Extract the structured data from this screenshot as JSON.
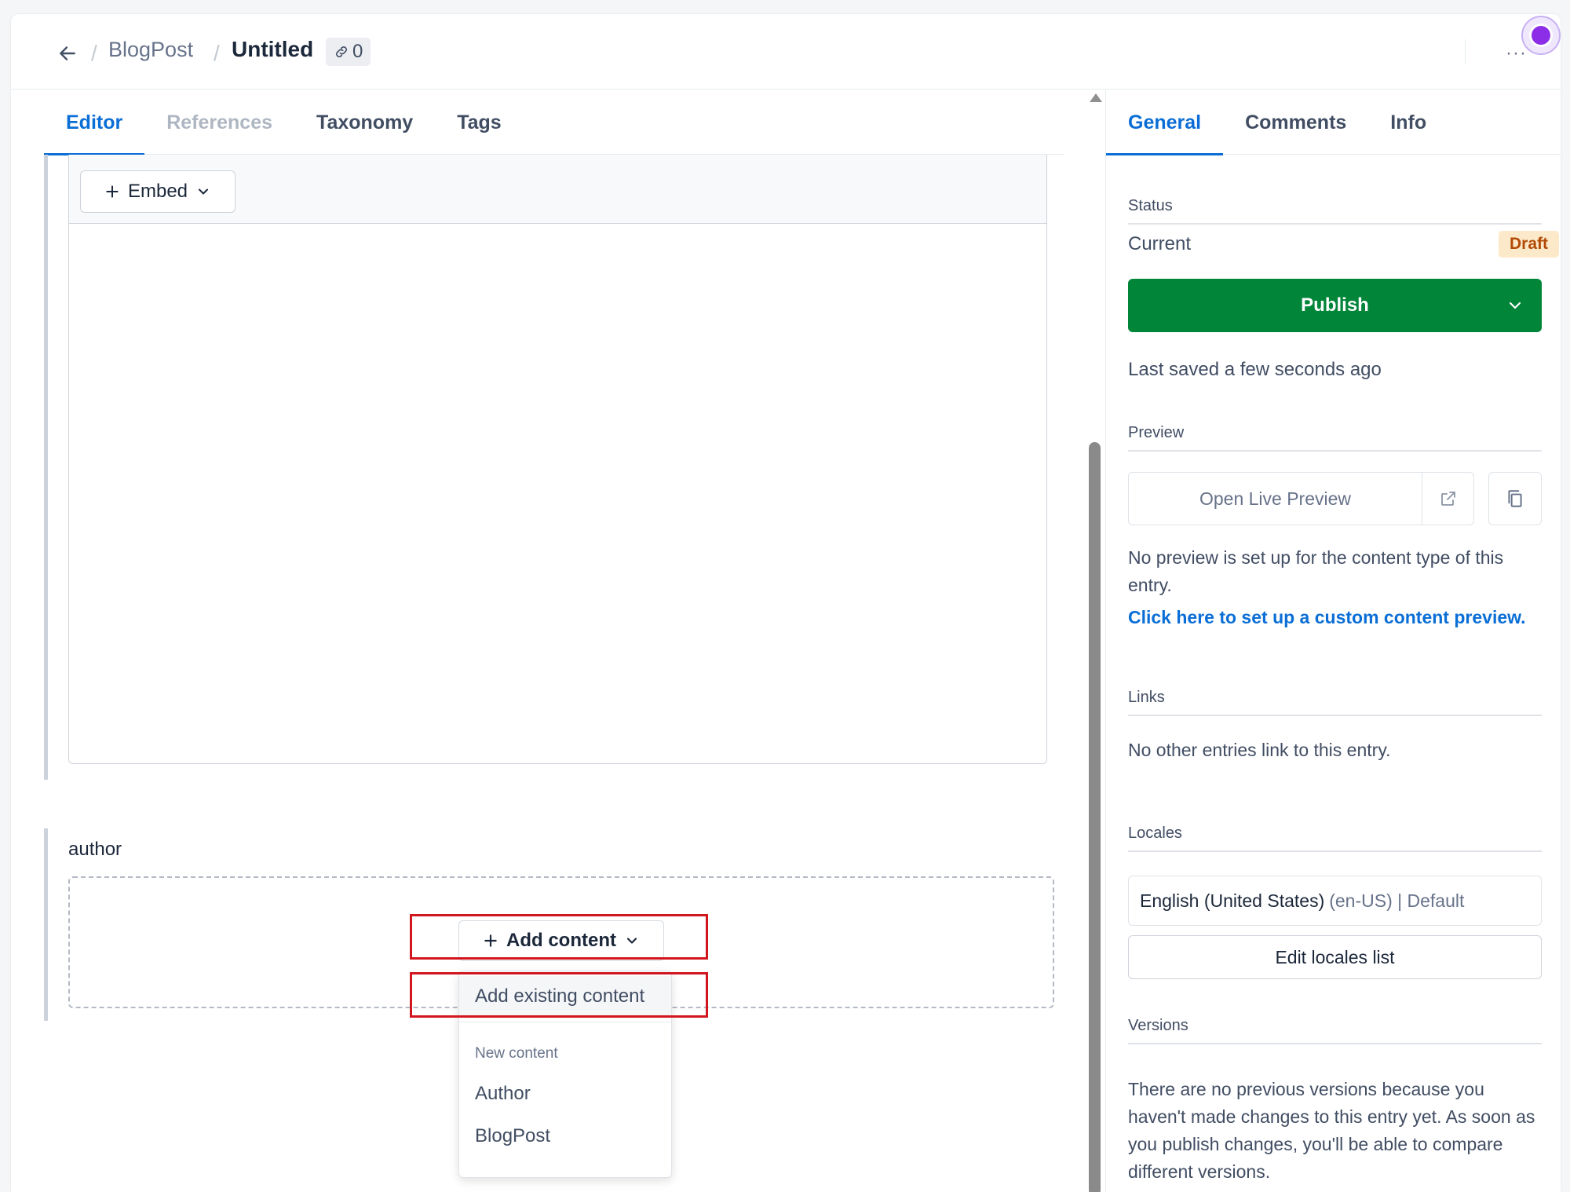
{
  "header": {
    "back_icon": "arrow-left-icon",
    "content_type": "BlogPost",
    "entry_title": "Untitled",
    "reference_count": "0",
    "link_icon": "link-icon",
    "more_label": "···"
  },
  "left_tabs": [
    {
      "label": "Editor",
      "state": "active"
    },
    {
      "label": "References",
      "state": "disabled"
    },
    {
      "label": "Taxonomy",
      "state": "normal"
    },
    {
      "label": "Tags",
      "state": "normal"
    }
  ],
  "editor": {
    "embed_label": "Embed",
    "author_field_label": "author",
    "add_content_label": "Add content",
    "dropdown": {
      "existing_label": "Add existing content",
      "new_heading": "New content",
      "new_items": [
        "Author",
        "BlogPost"
      ]
    }
  },
  "sidebar": {
    "tabs": [
      {
        "label": "General",
        "state": "active"
      },
      {
        "label": "Comments",
        "state": "normal"
      },
      {
        "label": "Info",
        "state": "normal"
      }
    ],
    "status": {
      "title": "Status",
      "current_label": "Current",
      "badge": "Draft",
      "badge_color": "#fce9c9",
      "publish_label": "Publish",
      "publish_color": "#008539",
      "last_saved": "Last saved a few seconds ago"
    },
    "preview": {
      "title": "Preview",
      "button_label": "Open Live Preview",
      "message": "No preview is set up for the content type of this entry.",
      "link": "Click here to set up a custom content preview."
    },
    "links": {
      "title": "Links",
      "message": "No other entries link to this entry."
    },
    "locales": {
      "title": "Locales",
      "locale_name": "English (United States)",
      "locale_code": "(en-US) | Default",
      "edit_button": "Edit locales list"
    },
    "versions": {
      "title": "Versions",
      "message": "There are no previous versions because you haven't made changes to this entry yet. As soon as you publish changes, you'll be able to compare different versions."
    }
  },
  "colors": {
    "accent": "#0a6ed6",
    "highlight_box": "#d2161e"
  }
}
